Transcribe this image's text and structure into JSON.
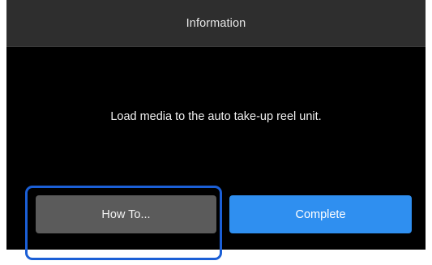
{
  "dialog": {
    "title": "Information",
    "message": "Load media to the auto take-up reel unit."
  },
  "buttons": {
    "how_to_label": "How To...",
    "complete_label": "Complete"
  },
  "colors": {
    "titlebar": "#2e2e2e",
    "background": "#000000",
    "how_to_button": "#5b5b5b",
    "complete_button": "#2f8ff0",
    "highlight_outline": "#1b5fd6"
  }
}
